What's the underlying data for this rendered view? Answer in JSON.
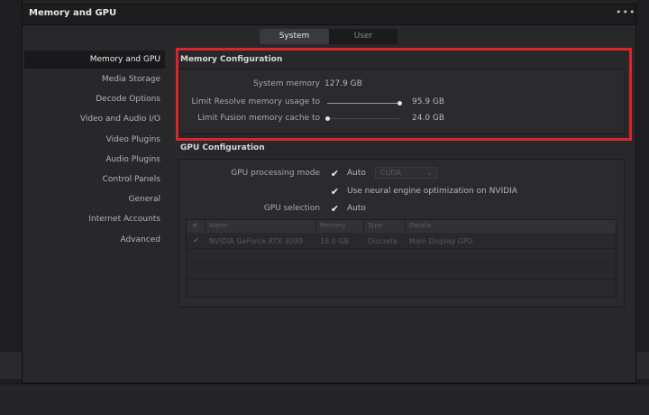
{
  "window": {
    "title": "Memory and GPU",
    "menu_icon": "ellipsis-icon"
  },
  "tabs": [
    {
      "label": "System",
      "active": true
    },
    {
      "label": "User",
      "active": false
    }
  ],
  "sidebar": {
    "items": [
      {
        "label": "Memory and GPU",
        "active": true
      },
      {
        "label": "Media Storage"
      },
      {
        "label": "Decode Options"
      },
      {
        "label": "Video and Audio I/O"
      },
      {
        "label": "Video Plugins"
      },
      {
        "label": "Audio Plugins"
      },
      {
        "label": "Control Panels"
      },
      {
        "label": "General"
      },
      {
        "label": "Internet Accounts"
      },
      {
        "label": "Advanced"
      }
    ]
  },
  "memory_config": {
    "title": "Memory Configuration",
    "system_memory_label": "System memory",
    "system_memory_value": "127.9 GB",
    "resolve_limit_label": "Limit Resolve memory usage to",
    "resolve_limit_value": "95.9 GB",
    "resolve_limit_fraction": 1.0,
    "fusion_limit_label": "Limit Fusion memory cache to",
    "fusion_limit_value": "24.0 GB",
    "fusion_limit_fraction": 0.0
  },
  "gpu_config": {
    "title": "GPU Configuration",
    "processing_mode_label": "GPU processing mode",
    "processing_mode_auto_checked": true,
    "processing_mode_auto_label": "Auto",
    "processing_mode_select": "CUDA",
    "neural_engine_checked": true,
    "neural_engine_label": "Use neural engine optimization on NVIDIA",
    "gpu_selection_label": "GPU selection",
    "gpu_selection_auto_checked": true,
    "gpu_selection_auto_label": "Auto",
    "table": {
      "columns": [
        "#",
        "Name",
        "Memory",
        "Type",
        "Details"
      ],
      "rows": [
        {
          "index_checked": true,
          "name": "NVIDIA GeForce RTX 3090",
          "memory": "18.0 GB",
          "type": "Discrete",
          "details": "Main Display GPU"
        }
      ]
    }
  },
  "colors": {
    "highlight": "#d8262e",
    "background": "#28282b"
  }
}
